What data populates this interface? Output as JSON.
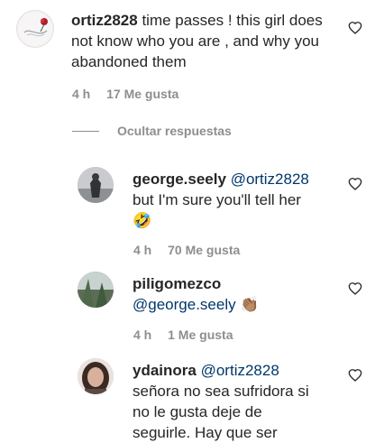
{
  "comments": [
    {
      "username": "ortiz2828",
      "text": "time passes ! this girl does not know who you are , and why you abandoned them",
      "time": "4 h",
      "likes": "17 Me gusta"
    }
  ],
  "hide_replies_label": "Ocultar respuestas",
  "replies": [
    {
      "username": "george.seely",
      "mention": "@ortiz2828",
      "text": "but I'm sure you'll tell her",
      "emoji": "🤣",
      "time": "4 h",
      "likes": "70 Me gusta"
    },
    {
      "username": "piligomezco",
      "mention": "@george.seely",
      "emoji": "👏🏽",
      "time": "4 h",
      "likes": "1 Me gusta"
    },
    {
      "username": "ydainora",
      "mention": "@ortiz2828",
      "line2": "señora no sea sufridora si",
      "line3": "no le gusta deje de",
      "line4": "seguirle. Hay que ser"
    }
  ]
}
